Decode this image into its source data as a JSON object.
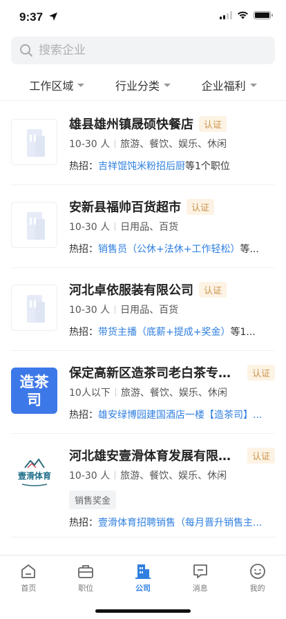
{
  "status": {
    "time": "9:37"
  },
  "search": {
    "placeholder": "搜索企业"
  },
  "filters": [
    {
      "label": "工作区域"
    },
    {
      "label": "行业分类"
    },
    {
      "label": "企业福利"
    }
  ],
  "companies": [
    {
      "name": "雄县雄州镇晟硕快餐店",
      "badge": "认证",
      "size": "10-30 人",
      "industry": "旅游、餐饮、娱乐、休闲",
      "hot_prefix": "热招：",
      "hot_job": "吉祥馄饨米粉招后厨",
      "hot_suffix": "等1个职位"
    },
    {
      "name": "安新县福帅百货超市",
      "badge": "认证",
      "size": "10-30 人",
      "industry": "日用品、百货",
      "hot_prefix": "热招：",
      "hot_job": "销售员（公休+法休+工作轻松）",
      "hot_suffix": "等..."
    },
    {
      "name": "河北卓依服装有限公司",
      "badge": "认证",
      "size": "10-30 人",
      "industry": "日用品、百货",
      "hot_prefix": "热招：",
      "hot_job": "带货主播（底薪+提成+奖金）",
      "hot_suffix": "等1..."
    },
    {
      "name": "保定高新区造茶司老白茶专...",
      "badge": "认证",
      "logo_text": "造茶司",
      "size": "10人以下",
      "industry": "旅游、餐饮、娱乐、休闲",
      "hot_prefix": "热招：",
      "hot_job": "雄安绿博园建国酒店一楼【造茶司】...",
      "hot_suffix": ""
    },
    {
      "name": "河北雄安壹滑体育发展有限...",
      "badge": "认证",
      "logo_text": "壹滑体育",
      "size": "10-30 人",
      "industry": "旅游、餐饮、娱乐、休闲",
      "tag": "销售奖金",
      "hot_prefix": "热招：",
      "hot_job": "壹滑体育招聘销售（每月晋升销售主...",
      "hot_suffix": ""
    }
  ],
  "tabbar": [
    {
      "label": "首页",
      "icon": "home-icon"
    },
    {
      "label": "职位",
      "icon": "briefcase-icon"
    },
    {
      "label": "公司",
      "icon": "building-icon",
      "active": true
    },
    {
      "label": "消息",
      "icon": "message-icon"
    },
    {
      "label": "我的",
      "icon": "profile-icon"
    }
  ],
  "colors": {
    "accent": "#2f7fe0",
    "badge_text": "#c9924a",
    "badge_bg": "#fdf3e4",
    "logo_blue": "#3d78e8"
  }
}
